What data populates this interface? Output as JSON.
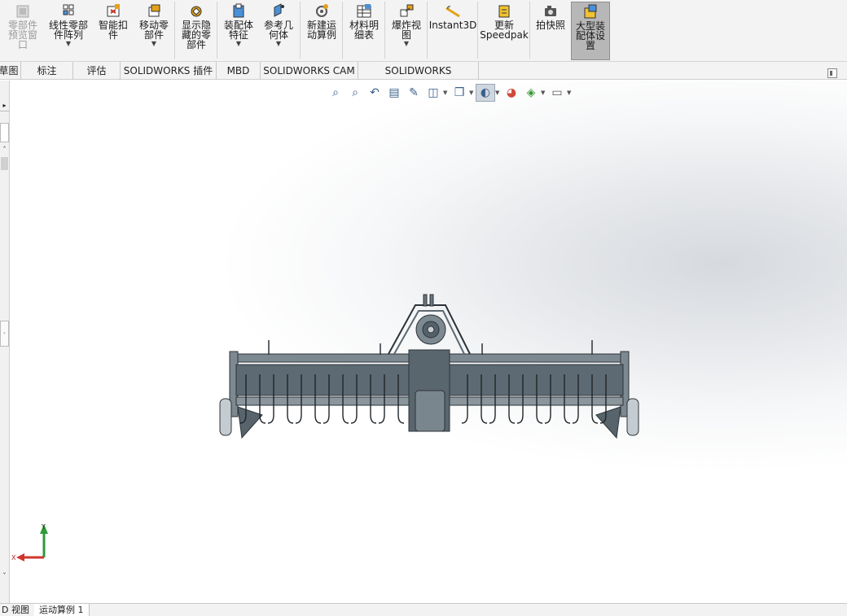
{
  "ribbon": {
    "buttons": [
      {
        "label": "零部件\n预览窗\n口",
        "icon": "preview-window-icon",
        "disabled": true
      },
      {
        "label": "线性零部\n件阵列",
        "icon": "linear-pattern-icon",
        "dropdown": true
      },
      {
        "label": "智能扣\n件",
        "icon": "smart-fastener-icon"
      },
      {
        "label": "移动零\n部件",
        "icon": "move-component-icon",
        "dropdown": true
      },
      {
        "label": "显示隐\n藏的零\n部件",
        "icon": "show-hidden-icon"
      },
      {
        "label": "装配体\n特征",
        "icon": "assembly-feature-icon",
        "dropdown": true
      },
      {
        "label": "参考几\n何体",
        "icon": "reference-geometry-icon",
        "dropdown": true
      },
      {
        "label": "新建运\n动算例",
        "icon": "motion-study-icon"
      },
      {
        "label": "材料明\n细表",
        "icon": "bom-icon"
      },
      {
        "label": "爆炸视\n图",
        "icon": "exploded-view-icon",
        "dropdown": true
      },
      {
        "label": "Instant3D",
        "icon": "instant3d-icon"
      },
      {
        "label": "更新\nSpeedpak",
        "icon": "speedpak-icon"
      },
      {
        "label": "拍快照",
        "icon": "snapshot-icon"
      },
      {
        "label": "大型装\n配体设\n置",
        "icon": "large-assembly-icon",
        "active": true
      }
    ]
  },
  "tabs": [
    "草图",
    "标注",
    "评估",
    "SOLIDWORKS 插件",
    "MBD",
    "SOLIDWORKS CAM",
    "SOLIDWORKS Inspection"
  ],
  "bottom_tabs": [
    "D 视图",
    "运动算例 1"
  ],
  "triad": {
    "x": "X",
    "y": "Y"
  },
  "colors": {
    "ribbon_bg": "#f3f3f3",
    "model": "#5d6a73",
    "x_axis": "#d0342c",
    "y_axis": "#2f9a3a"
  }
}
